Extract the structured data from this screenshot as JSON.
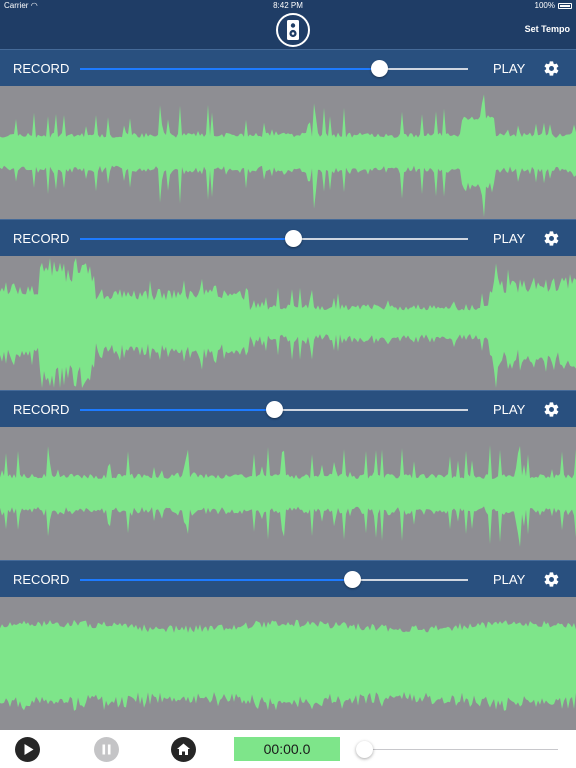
{
  "status_bar": {
    "carrier": "Carrier",
    "time": "8:42 PM",
    "battery": "100%"
  },
  "header": {
    "set_tempo_label": "Set Tempo",
    "app_icon": "speaker-icon"
  },
  "tracks": [
    {
      "record_label": "RECORD",
      "play_label": "PLAY",
      "volume": 0.77,
      "settings_icon": "gear-icon",
      "seed": 11,
      "profile": "spiky"
    },
    {
      "record_label": "RECORD",
      "play_label": "PLAY",
      "volume": 0.55,
      "settings_icon": "gear-icon",
      "seed": 23,
      "profile": "loud"
    },
    {
      "record_label": "RECORD",
      "play_label": "PLAY",
      "volume": 0.5,
      "settings_icon": "gear-icon",
      "seed": 37,
      "profile": "spiky"
    },
    {
      "record_label": "RECORD",
      "play_label": "PLAY",
      "volume": 0.7,
      "settings_icon": "gear-icon",
      "seed": 51,
      "profile": "dense"
    }
  ],
  "transport": {
    "time": "00:00.0",
    "position": 0.0,
    "play_icon": "play-icon",
    "pause_icon": "pause-icon",
    "home_icon": "home-icon"
  },
  "colors": {
    "nav": "#1f3d66",
    "track_bar": "#29507f",
    "waveform": "#7ee58a",
    "wave_bg": "#8e8e93",
    "slider_fill": "#1e7bff"
  }
}
